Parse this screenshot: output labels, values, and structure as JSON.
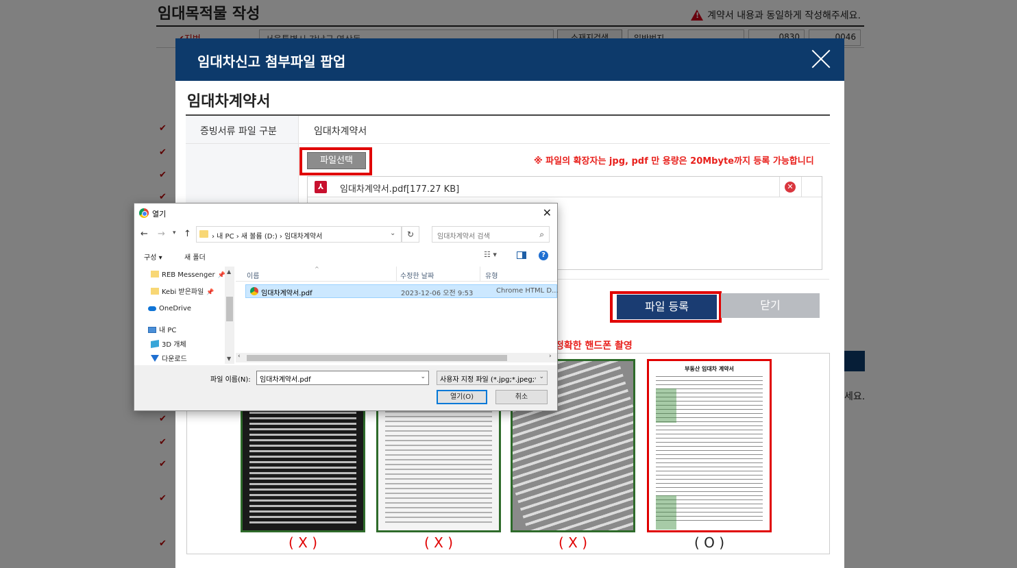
{
  "background": {
    "title": "임대목적물 작성",
    "notice": "계약서 내용과 동일하게 작성해주세요.",
    "row": {
      "label": "✔지번",
      "address": "서울특별시 강남구 역삼동",
      "button": "소재지검색",
      "select": "일반번지",
      "num1": "0830",
      "num2": "0046"
    },
    "right_text": "세요."
  },
  "modal": {
    "title": "임대차신고 첨부파일 팝업",
    "section_title": "임대차계약서",
    "doc_type_label": "증빙서류 파일 구분",
    "doc_type_value": "임대차계약서",
    "file_select_label": "파일선택",
    "ext_notice": "※ 파일의 확장자는 jpg, pdf 만 용량은 20Mbyte까지 등록 가능합니디",
    "attached_file": "임대차계약서.pdf[177.27 KB]",
    "register_label": "파일 등록",
    "close_label": "닫기",
    "photo_caption": "정확한 핸드폰 촬영",
    "examples": [
      {
        "mark": "( X )"
      },
      {
        "mark": "( X )"
      },
      {
        "mark": "( X )"
      },
      {
        "mark": "( O )",
        "doc_title": "부동산 임대차 계약서"
      }
    ]
  },
  "dialog": {
    "title": "열기",
    "address_path": "› 내 PC › 새 볼륨 (D:) › 임대차계약서",
    "search_placeholder": "임대차계약서 검색",
    "organize": "구성 ▾",
    "new_folder": "새 폴더",
    "nav_items": [
      {
        "label": "REB Messenger",
        "icon": "folder-icon"
      },
      {
        "label": "Kebi 받은파일",
        "icon": "folder-icon"
      },
      {
        "label": "OneDrive",
        "icon": "cloud-icon"
      },
      {
        "label": "내 PC",
        "icon": "pc-icon"
      },
      {
        "label": "3D 개체",
        "icon": "cube-icon"
      },
      {
        "label": "다운로드",
        "icon": "download-icon"
      }
    ],
    "columns": {
      "name": "이름",
      "date": "수정한 날짜",
      "type": "유형"
    },
    "file": {
      "name": "임대차계약서.pdf",
      "date": "2023-12-06 오전 9:53",
      "type": "Chrome HTML D..."
    },
    "filename_label": "파일 이름(N):",
    "filename_value": "임대차계약서.pdf",
    "filter_value": "사용자 지정 파일 (*.jpg;*.jpeg;*",
    "open_label": "열기(O)",
    "cancel_label": "취소"
  }
}
